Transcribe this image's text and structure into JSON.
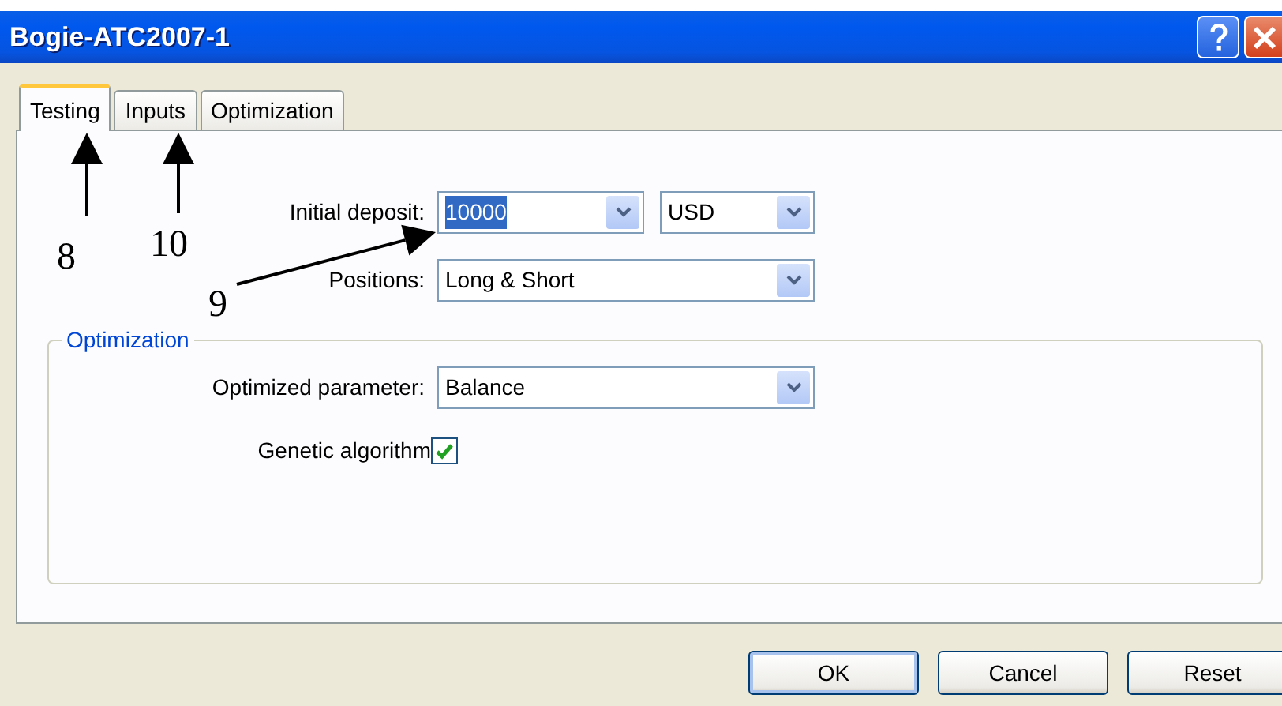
{
  "window": {
    "title": "Bogie-ATC2007-1"
  },
  "tabs": [
    {
      "label": "Testing",
      "selected": true
    },
    {
      "label": "Inputs",
      "selected": false
    },
    {
      "label": "Optimization",
      "selected": false
    }
  ],
  "testing": {
    "initial_deposit": {
      "label": "Initial deposit:",
      "value": "10000",
      "value_selected": true,
      "currency": "USD"
    },
    "positions": {
      "label": "Positions:",
      "value": "Long & Short"
    }
  },
  "optimization_group": {
    "legend": "Optimization",
    "parameter": {
      "label": "Optimized parameter:",
      "value": "Balance"
    },
    "genetic": {
      "label": "Genetic algorithm",
      "checked": true
    }
  },
  "buttons": [
    {
      "label": "OK",
      "default": true
    },
    {
      "label": "Cancel",
      "default": false
    },
    {
      "label": "Reset",
      "default": false
    }
  ],
  "annotations": [
    {
      "number": "8"
    },
    {
      "number": "10"
    },
    {
      "number": "9"
    }
  ]
}
